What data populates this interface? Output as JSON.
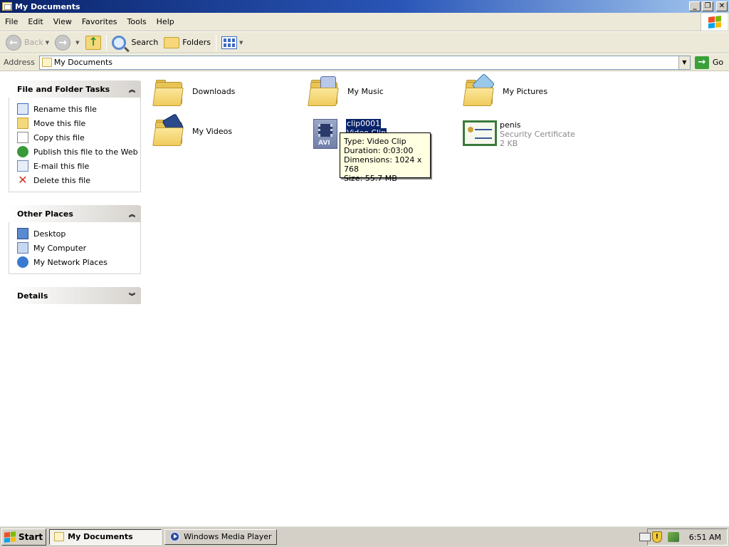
{
  "window": {
    "title": "My Documents",
    "caption_buttons": {
      "minimize": "_",
      "restore": "❐",
      "close": "✕"
    }
  },
  "menu": {
    "items": [
      "File",
      "Edit",
      "View",
      "Favorites",
      "Tools",
      "Help"
    ]
  },
  "toolbar": {
    "back_label": "Back",
    "search_label": "Search",
    "folders_label": "Folders"
  },
  "address": {
    "label": "Address",
    "value": "My Documents",
    "go_label": "Go"
  },
  "file_tasks": {
    "title": "File and Folder Tasks",
    "items": [
      {
        "label": "Rename this file",
        "icon": "rename-icon"
      },
      {
        "label": "Move this file",
        "icon": "move-icon"
      },
      {
        "label": "Copy this file",
        "icon": "copy-icon"
      },
      {
        "label": "Publish this file to the Web",
        "icon": "publish-icon"
      },
      {
        "label": "E-mail this file",
        "icon": "email-icon"
      },
      {
        "label": "Delete this file",
        "icon": "delete-icon"
      }
    ]
  },
  "other_places": {
    "title": "Other Places",
    "items": [
      {
        "label": "Desktop",
        "icon": "desktop-icon"
      },
      {
        "label": "My Computer",
        "icon": "my-computer-icon"
      },
      {
        "label": "My Network Places",
        "icon": "network-places-icon"
      }
    ]
  },
  "details": {
    "title": "Details"
  },
  "files": {
    "items": [
      {
        "name": "Downloads",
        "type": "folder"
      },
      {
        "name": "My Music",
        "type": "folder"
      },
      {
        "name": "My Pictures",
        "type": "folder"
      },
      {
        "name": "My Videos",
        "type": "folder"
      },
      {
        "name": "clip0001",
        "subtitle": "Video Clip",
        "type": "video",
        "icon_text": "AVI"
      },
      {
        "name": "penis",
        "subtitle": "Security Certificate",
        "size": "2 KB",
        "type": "certificate"
      }
    ]
  },
  "tooltip": {
    "lines": [
      "Type: Video Clip",
      "Duration: 0:03:00",
      "Dimensions: 1024 x 768",
      "Size: 55.7 MB"
    ]
  },
  "taskbar": {
    "start_label": "Start",
    "tasks": [
      "My Documents",
      "Windows Media Player"
    ],
    "clock": "6:51 AM"
  },
  "colors": {
    "title_bar": "#0a246a",
    "selection": "#0a246a",
    "tooltip_bg": "#ffffe1",
    "task_pane_header": "#d6d3ce"
  }
}
